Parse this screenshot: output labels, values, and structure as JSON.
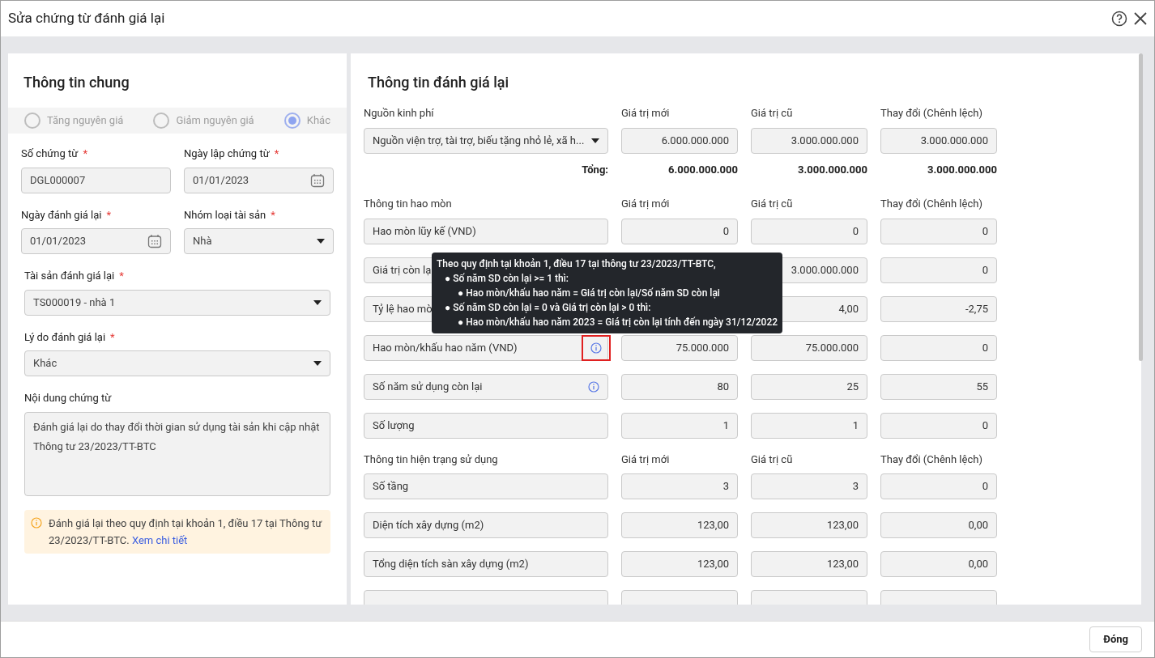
{
  "window": {
    "title": "Sửa chứng từ đánh giá lại"
  },
  "general": {
    "title": "Thông tin chung",
    "radios": [
      {
        "label": "Tăng nguyên giá",
        "selected": false
      },
      {
        "label": "Giảm nguyên giá",
        "selected": false
      },
      {
        "label": "Khác",
        "selected": true
      }
    ],
    "field_rows": [
      [
        {
          "kind": "text",
          "label": "Số chứng từ",
          "required_mark": "*",
          "value": "DGL000007"
        },
        {
          "kind": "date",
          "label": "Ngày lập chứng từ",
          "required_mark": "*",
          "value": "01/01/2023"
        }
      ],
      [
        {
          "kind": "date",
          "label": "Ngày đánh giá lại",
          "required_mark": "*",
          "value": "01/01/2023"
        },
        {
          "kind": "select",
          "label": "Nhóm loại tài sản",
          "required_mark": "*",
          "value": "Nhà"
        }
      ],
      [
        {
          "kind": "select",
          "label": "Tài sản đánh giá lại",
          "required_mark": "*",
          "value": "TS000019 - nhà 1"
        }
      ],
      [
        {
          "kind": "select",
          "label": "Lý do đánh giá lại",
          "required_mark": "*",
          "value": "Khác"
        }
      ],
      [
        {
          "kind": "textarea",
          "label": "Nội dung chứng từ",
          "value": "Đánh giá lại do thay đổi thời gian sử dụng tài sản khi cập nhật Thông tư 23/2023/TT-BTC"
        }
      ]
    ],
    "notice": {
      "text": "Đánh giá lại theo quy định tại khoản 1, điều 17 tại Thông tư 23/2023/TT-BTC.",
      "link": "Xem chi tiết"
    }
  },
  "revaluation": {
    "title": "Thông tin đánh giá lại",
    "sections": [
      {
        "columns": [
          "Nguồn kinh phí",
          "Giá trị mới",
          "Giá trị cũ",
          "Thay đổi (Chênh lệch)"
        ],
        "rows": [
          {
            "kind": "select",
            "label": "Nguồn viện trợ, tài trợ, biếu tặng nhỏ lẻ, xã h...",
            "new": "6.000.000.000",
            "old": "3.000.000.000",
            "diff": "3.000.000.000"
          }
        ],
        "total": {
          "label": "Tổng:",
          "values": [
            "6.000.000.000",
            "3.000.000.000",
            "3.000.000.000"
          ]
        }
      },
      {
        "columns": [
          "Thông tin hao mòn",
          "Giá trị mới",
          "Giá trị cũ",
          "Thay đổi (Chênh lệch)"
        ],
        "rows": [
          {
            "kind": "text",
            "label": "Hao mòn lũy kế (VND)",
            "new": "0",
            "old": "0",
            "diff": "0"
          },
          {
            "kind": "text",
            "label": "Giá trị còn lạ",
            "old": "3.000.000.000",
            "diff": "0"
          },
          {
            "kind": "text",
            "label": "Tỷ lệ hao mò",
            "old": "4,00",
            "diff": "-2,75"
          },
          {
            "kind": "info",
            "label": "Hao mòn/khấu hao năm (VND)",
            "highlighted": true,
            "new": "75.000.000",
            "old": "75.000.000",
            "diff": "0"
          },
          {
            "kind": "info",
            "label": "Số năm sử dụng còn lại",
            "highlighted": false,
            "new": "80",
            "old": "25",
            "diff": "55"
          },
          {
            "kind": "text",
            "label": "Số lượng",
            "new": "1",
            "old": "1",
            "diff": "0"
          }
        ]
      },
      {
        "columns": [
          "Thông tin hiện trạng sử dụng",
          "Giá trị mới",
          "Giá trị cũ",
          "Thay đổi (Chênh lệch)"
        ],
        "rows": [
          {
            "kind": "text",
            "label": "Số tầng",
            "new": "3",
            "old": "3",
            "diff": "0"
          },
          {
            "kind": "text",
            "label": "Diện tích xây dựng (m2)",
            "new": "123,00",
            "old": "123,00",
            "diff": "0,00"
          },
          {
            "kind": "text",
            "label": "Tổng diện tích sàn xây dựng (m2)",
            "new": "123,00",
            "old": "123,00",
            "diff": "0,00"
          },
          {
            "kind": "blank"
          }
        ]
      }
    ],
    "tooltip": {
      "title": "Theo quy định tại khoản 1, điều 17 tại thông tư 23/2023/TT-BTC,",
      "items": [
        {
          "bullet": "●",
          "text": "Số năm SD còn lại >= 1 thì:",
          "children": [
            {
              "bullet": "●",
              "text": "Hao mòn/khấu hao năm = Giá trị còn lại/Số năm SD còn lại"
            }
          ]
        },
        {
          "bullet": "●",
          "text": "Số năm SD còn lại = 0 và Giá trị còn lại > 0 thì:",
          "children": [
            {
              "bullet": "●",
              "text": "Hao mòn/khấu hao năm 2023 = Giá trị còn lại tính đến ngày 31/12/2022"
            }
          ]
        }
      ]
    }
  },
  "footer": {
    "close_button": "Đóng"
  }
}
